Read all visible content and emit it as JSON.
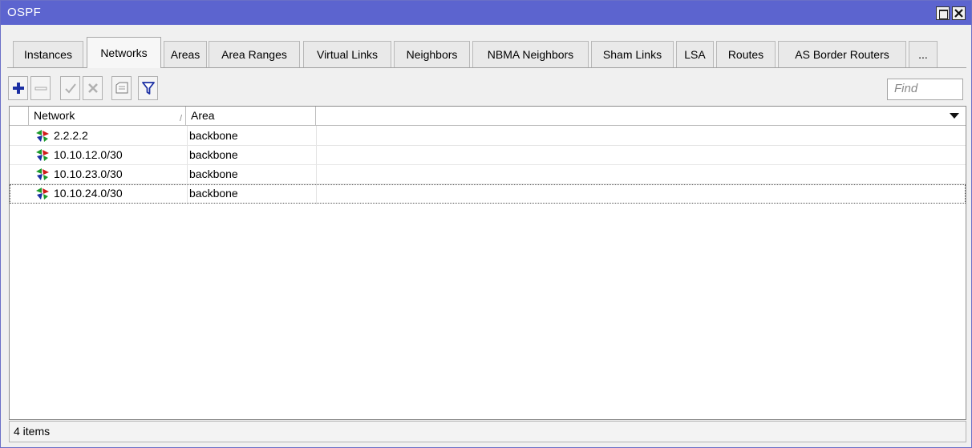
{
  "window": {
    "title": "OSPF"
  },
  "tabs": [
    {
      "label": "Instances"
    },
    {
      "label": "Networks"
    },
    {
      "label": "Areas"
    },
    {
      "label": "Area Ranges"
    },
    {
      "label": "Virtual Links"
    },
    {
      "label": "Neighbors"
    },
    {
      "label": "NBMA Neighbors"
    },
    {
      "label": "Sham Links"
    },
    {
      "label": "LSA"
    },
    {
      "label": "Routes"
    },
    {
      "label": "AS Border Routers"
    },
    {
      "label": "..."
    }
  ],
  "active_tab": "Networks",
  "toolbar": {
    "buttons": [
      "add-icon",
      "remove-icon",
      "enable-icon",
      "disable-icon",
      "comment-icon",
      "filter-icon"
    ],
    "find_placeholder": "Find"
  },
  "table": {
    "columns": [
      "Network",
      "Area"
    ],
    "sort_indicator": "/",
    "rows": [
      {
        "network": "2.2.2.2",
        "area": "backbone"
      },
      {
        "network": "10.10.12.0/30",
        "area": "backbone"
      },
      {
        "network": "10.10.23.0/30",
        "area": "backbone"
      },
      {
        "network": "10.10.24.0/30",
        "area": "backbone"
      }
    ],
    "selected_row": 3
  },
  "status": {
    "text": "4 items"
  },
  "colors": {
    "titlebar": "#5c64cf",
    "add_icon": "#1b2fa3",
    "filter_icon": "#1b2fa3"
  }
}
